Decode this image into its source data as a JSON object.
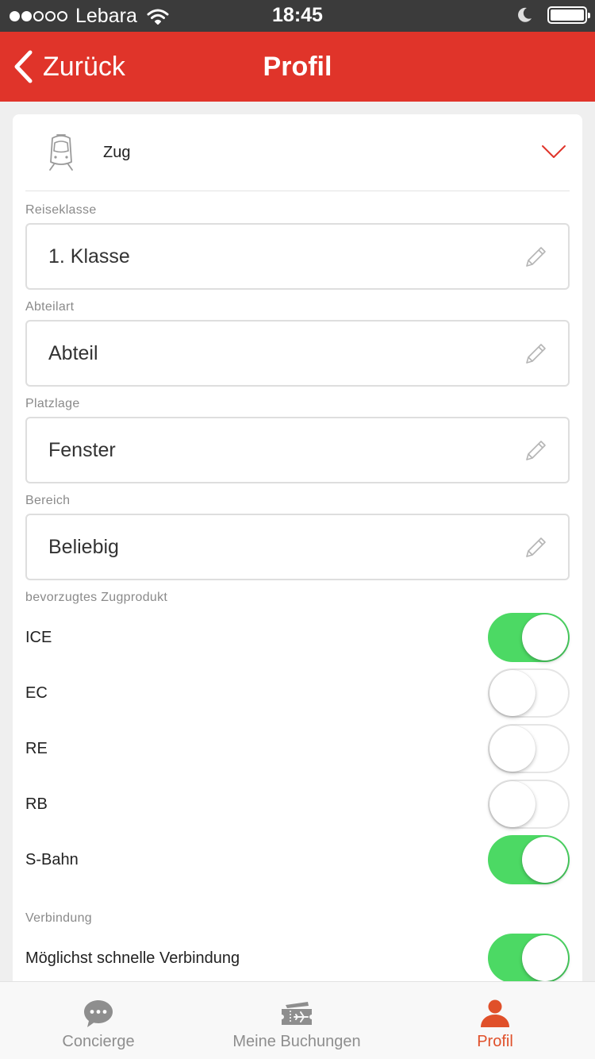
{
  "status_bar": {
    "carrier": "Lebara",
    "time": "18:45",
    "signal_filled": 2,
    "signal_total": 5
  },
  "nav": {
    "back_label": "Zurück",
    "title": "Profil"
  },
  "transport": {
    "label": "Zug",
    "icon": "train-icon"
  },
  "fields": [
    {
      "caption": "Reiseklasse",
      "value": "1. Klasse"
    },
    {
      "caption": "Abteilart",
      "value": "Abteil"
    },
    {
      "caption": "Platzlage",
      "value": "Fenster"
    },
    {
      "caption": "Bereich",
      "value": "Beliebig"
    }
  ],
  "products": {
    "caption": "bevorzugtes Zugprodukt",
    "items": [
      {
        "label": "ICE",
        "on": true
      },
      {
        "label": "EC",
        "on": false
      },
      {
        "label": "RE",
        "on": false
      },
      {
        "label": "RB",
        "on": false
      },
      {
        "label": "S-Bahn",
        "on": true
      }
    ]
  },
  "connection": {
    "caption": "Verbindung",
    "items": [
      {
        "label": "Möglichst schnelle Verbindung",
        "on": true
      }
    ]
  },
  "tabs": [
    {
      "label": "Concierge",
      "icon": "chat-bubble-icon",
      "active": false
    },
    {
      "label": "Meine Buchungen",
      "icon": "ticket-icon",
      "active": false
    },
    {
      "label": "Profil",
      "icon": "person-icon",
      "active": true
    }
  ],
  "colors": {
    "nav_red": "#e0342a",
    "toggle_on": "#4cd964",
    "tab_active": "#e0502a",
    "tab_inactive": "#8e8e8e"
  }
}
